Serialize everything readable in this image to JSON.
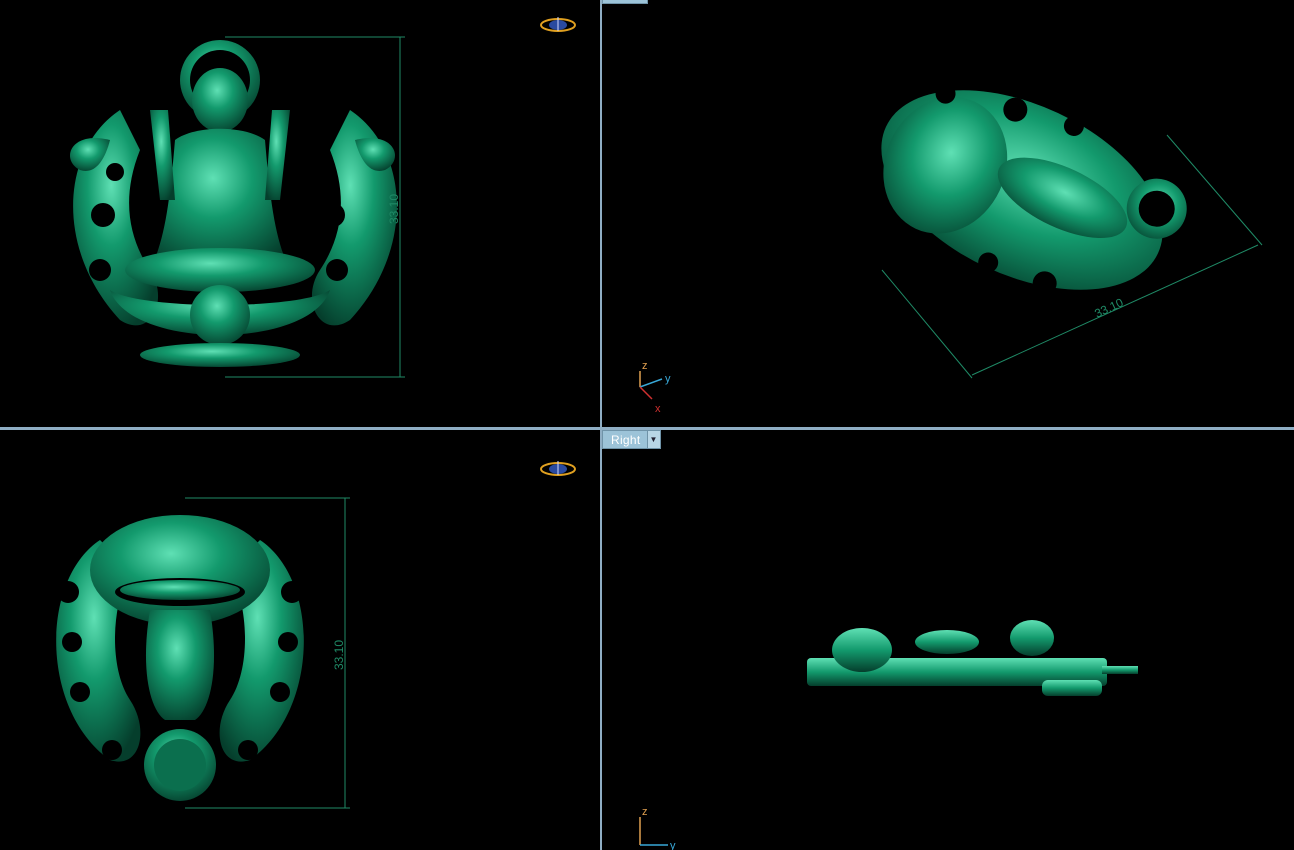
{
  "viewports": {
    "top_left": {
      "dimension": "33.10"
    },
    "top_right": {
      "dimension": "33.10",
      "axes": {
        "z": "z",
        "y": "y",
        "x": "x"
      }
    },
    "bottom_left": {
      "dimension": "33.10"
    },
    "bottom_right": {
      "tab_label": "Right",
      "axes": {
        "z": "z",
        "y": "y"
      }
    }
  },
  "colors": {
    "model": "#0f8a62",
    "model_highlight": "#3fd1a0",
    "model_shadow": "#064d37",
    "background": "#000000",
    "divider": "#8faec4",
    "dimension_line": "#1f8a66",
    "tab": "#9cc3d8",
    "axis_z": "#e0a050",
    "axis_y": "#38a8d8",
    "axis_x": "#d03030"
  },
  "icons": [
    "view-cube-icon",
    "dropdown-arrow-icon"
  ]
}
